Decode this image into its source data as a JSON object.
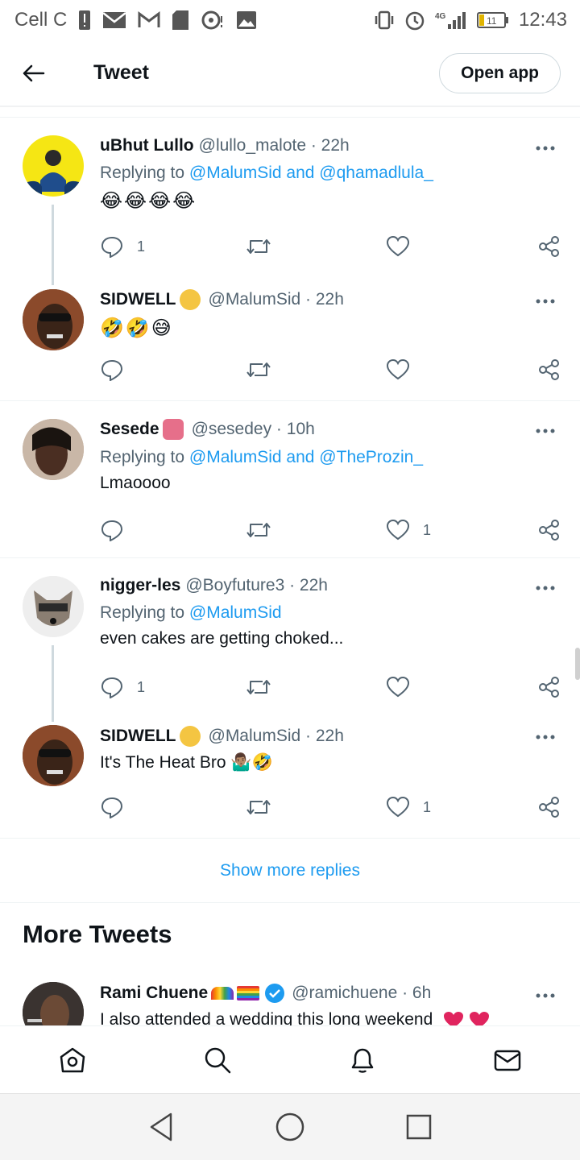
{
  "status": {
    "carrier": "Cell C",
    "network": "4G",
    "battery": "11",
    "time": "12:43"
  },
  "header": {
    "title": "Tweet",
    "open_app": "Open app"
  },
  "replies": [
    {
      "name": "uBhut Lullo",
      "handle": "@lullo_malote · 22h",
      "replying_prefix": "Replying to",
      "mentions": "@MalumSid and @qhamadlula_",
      "text": "",
      "emoji": "😂😂😂😂",
      "reply_count": "1",
      "like_count": ""
    },
    {
      "name": "SIDWELL",
      "handle": "@MalumSid · 22h",
      "text": "",
      "emoji": "🤣🤣😅",
      "reply_count": "",
      "like_count": ""
    },
    {
      "name": "Sesede",
      "handle": "@sesedey · 10h",
      "replying_prefix": "Replying to",
      "mentions": "@MalumSid and @TheProzin_",
      "text": "Lmaoooo",
      "reply_count": "",
      "like_count": "1"
    },
    {
      "name": "nigger-les",
      "handle": "@Boyfuture3 · 22h",
      "replying_prefix": "Replying to",
      "mentions": "@MalumSid",
      "text": "even cakes are getting choked...",
      "reply_count": "1",
      "like_count": ""
    },
    {
      "name": "SIDWELL",
      "handle": "@MalumSid · 22h",
      "text": "It's The Heat Bro",
      "emoji": "🤷🏽‍♂️🤣",
      "reply_count": "",
      "like_count": "1"
    }
  ],
  "show_more": "Show more replies",
  "more_tweets": {
    "heading": "More Tweets",
    "name": "Rami Chuene",
    "handle": "@ramichuene · 6h",
    "text": "I also attended a wedding this long weekend"
  },
  "colors": {
    "link": "#1d9bf0",
    "muted": "#536471",
    "text": "#0f1419"
  }
}
